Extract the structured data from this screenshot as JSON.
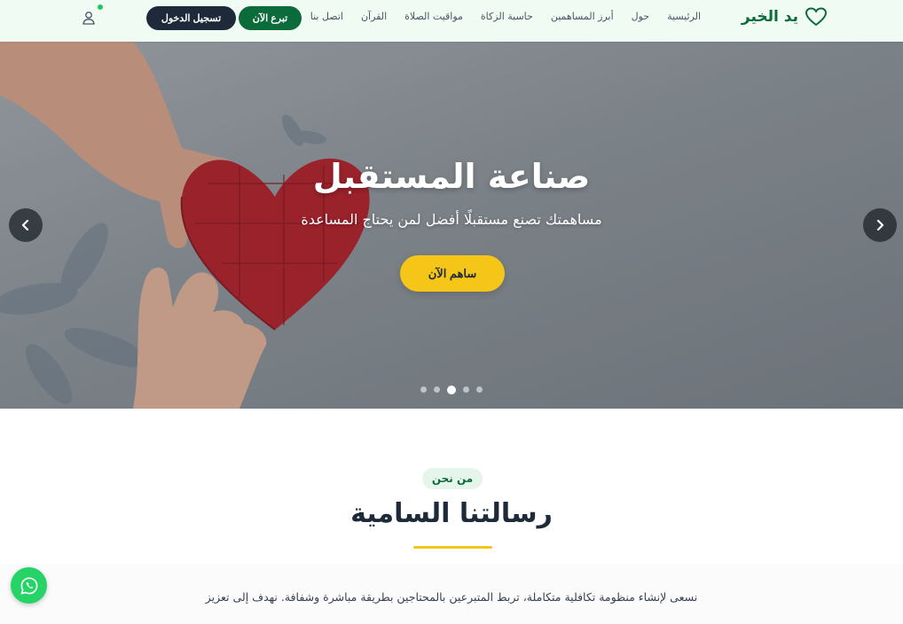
{
  "header": {
    "brand_name": "يد الخير",
    "brand_icon": "heart-outline-icon",
    "nav": [
      {
        "label": "الرئيسية"
      },
      {
        "label": "حول"
      },
      {
        "label": "أبرز المساهمين"
      },
      {
        "label": "حاسبة الزكاة"
      },
      {
        "label": "مواقيت الصلاة"
      },
      {
        "label": "القرآن"
      },
      {
        "label": "اتصل بنا"
      }
    ],
    "donate_label": "تبرع الآن",
    "login_label": "تسجيل الدخول",
    "user_icon": "user-icon"
  },
  "hero": {
    "title": "صناعة المستقبل",
    "subtitle": "مساهمتك تصنع مستقبلًا أفضل لمن يحتاج المساعدة",
    "cta_label": "ساهم الآن",
    "slide_count": 5,
    "active_slide": 3
  },
  "about": {
    "badge": "من نحن",
    "title": "رسالتنا السامية",
    "text": "نسعى لإنشاء منظومة تكافلية متكاملة، تربط المتبرعين بالمحتاجين بطريقة مباشرة وشفافة. نهدف إلى تعزيز"
  },
  "colors": {
    "brand_green": "#0b6b3a",
    "dark": "#1e2a3a",
    "accent_yellow": "#f5c518",
    "header_bg": "#f0fbf4",
    "whatsapp_green": "#25d366"
  }
}
